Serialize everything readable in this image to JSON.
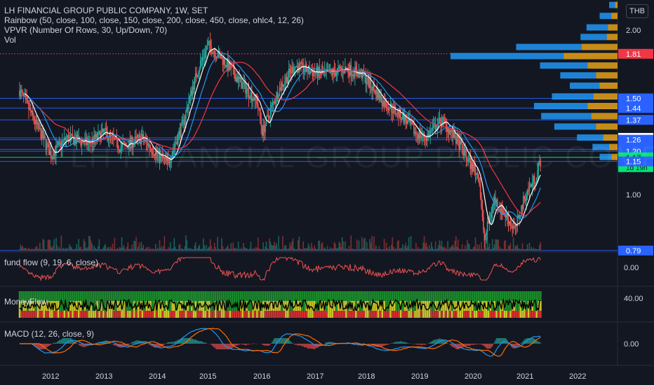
{
  "header": {
    "title": "LH FINANCIAL GROUP PUBLIC COMPANY, 1W, SET",
    "indicators": [
      "Rainbow (50, close, 100, close, 150, close, 200, close, 450, close, ohlc4, 12, 26)",
      "VPVR (Number Of Rows, 30, Up/Down, 70)",
      "Vol"
    ],
    "currency": "THB",
    "watermark": "LH FINANCIAL GROUP PUBLIC COMPANY"
  },
  "panes": {
    "fund_flow_label": "fund flow (9, 19, 6, close)",
    "moneyflow_label": "MoneyFlow",
    "macd_label": "MACD (12, 26, close, 9)"
  },
  "chart_data": {
    "type": "candlestick",
    "x_ticks": [
      "2012",
      "2013",
      "2014",
      "2015",
      "2016",
      "2017",
      "2018",
      "2019",
      "2020",
      "2021",
      "2022"
    ],
    "price_axis_ticks": [
      "2.00",
      "1.00"
    ],
    "price_levels": [
      {
        "value": "1.81",
        "color": "#f23645",
        "style": "dotted"
      },
      {
        "value": "1.50",
        "color": "#2962ff"
      },
      {
        "value": "1.44",
        "color": "#2962ff"
      },
      {
        "value": "1.37",
        "color": "#2962ff"
      },
      {
        "value": "1.27",
        "color": "#ffffff"
      },
      {
        "value": "1.26",
        "color": "#2962ff"
      },
      {
        "value": "1.21",
        "color": "#2962ff"
      },
      {
        "value": "1.20",
        "color": "#2962ff"
      },
      {
        "value": "1.17",
        "color": "#00e676",
        "countdown": "1d 19h"
      },
      {
        "value": "1.15",
        "color": "#2962ff"
      },
      {
        "value": "0.79",
        "color": "#2962ff"
      }
    ],
    "fund_flow_axis": [
      "0.00"
    ],
    "moneyflow_axis": [
      "40.00"
    ],
    "macd_axis": [
      "0.00"
    ]
  }
}
